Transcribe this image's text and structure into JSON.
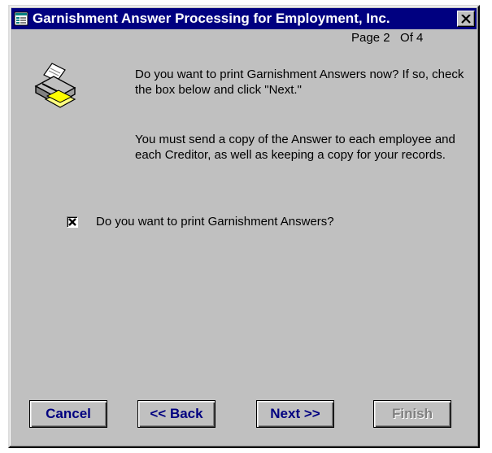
{
  "window": {
    "title": "Garnishment Answer Processing for Employment, Inc.",
    "page_indicator": "Page 2   Of 4"
  },
  "content": {
    "paragraph1": "Do you want to print Garnishment Answers now? If so, check the box below and click \"Next.\"",
    "paragraph2": "You must send a copy of the Answer to each employee and each Creditor, as well as keeping a copy for your records.",
    "checkbox": {
      "label": "Do you want to print Garnishment Answers?",
      "checked": true
    }
  },
  "buttons": {
    "cancel": "Cancel",
    "back": "<< Back",
    "next": "Next >>",
    "finish": "Finish"
  },
  "icons": {
    "app": "form-icon",
    "close": "close-icon",
    "main": "printer-icon"
  },
  "colors": {
    "titlebar": "#000080",
    "face": "#c0c0c0",
    "button_text": "#000080",
    "disabled_text": "#808080"
  }
}
